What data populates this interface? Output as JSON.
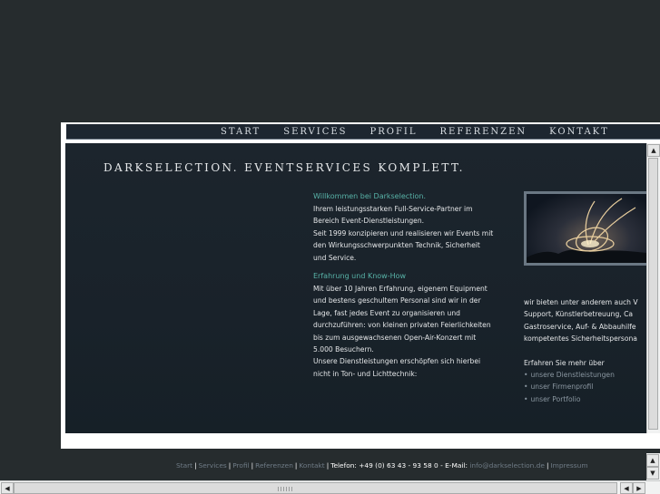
{
  "nav": {
    "items": [
      "START",
      "SERVICES",
      "PROFIL",
      "REFERENZEN",
      "KONTAKT"
    ]
  },
  "headline": "DARKSELECTION. EVENTSERVICES KOMPLETT.",
  "intro": {
    "title": "Willkommen bei Darkselection.",
    "lines": [
      "Ihrem leistungsstarken Full-Service-Partner im",
      "Bereich Event-Dienstleistungen.",
      "Seit 1999 konzipieren und realisieren wir Events mit",
      "den Wirkungsschwerpunkten Technik, Sicherheit",
      "und Service."
    ]
  },
  "experience": {
    "title": "Erfahrung und Know-How",
    "lines": [
      "Mit über 10 Jahren Erfahrung, eigenem Equipment",
      "und bestens geschultem Personal sind wir in der",
      "Lage, fast jedes Event zu organisieren und",
      "durchzuführen: von kleinen privaten Feierlichkeiten",
      "bis zum ausgewachsenen Open-Air-Konzert mit",
      "5.000 Besuchern.",
      "Unsere Dienstleistungen erschöpfen sich hierbei",
      "nicht in Ton- und Lichttechnik:"
    ]
  },
  "right": {
    "lines": [
      "wir bieten unter anderem auch V",
      "Support, Künstlerbetreuung, Ca",
      "Gastroservice, Auf- & Abbauhilfe",
      "kompetentes Sicherheitspersona"
    ],
    "more_title": "Erfahren Sie mehr über",
    "links": [
      "unsere Dienstleistungen",
      "unser Firmenprofil",
      "unser Portfolio"
    ]
  },
  "footer": {
    "links": [
      "Start",
      "Services",
      "Profil",
      "Referenzen",
      "Kontakt"
    ],
    "phone": "Telefon: +49 (0) 63 43 - 93 58 0",
    "email_label": "E-Mail:",
    "email": "info@darkselection.de",
    "impressum": "Impressum"
  },
  "colors": {
    "accent": "#58b3a8",
    "background": "#262c2e",
    "nav": "#1d2630"
  }
}
